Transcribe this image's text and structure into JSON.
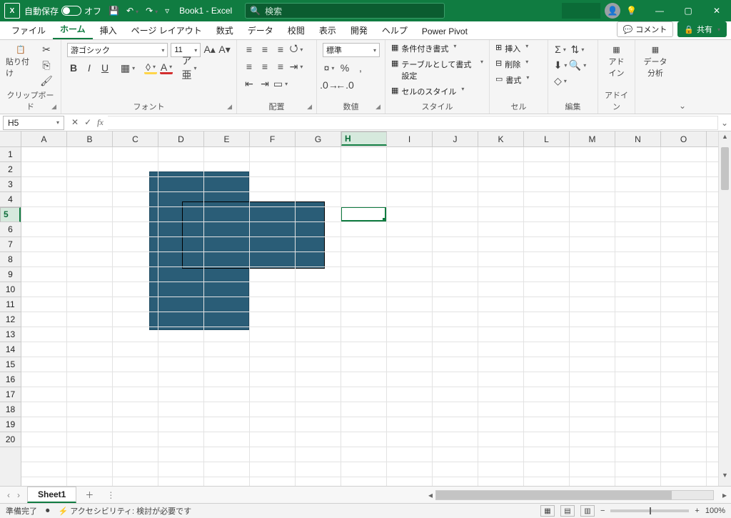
{
  "titlebar": {
    "autosave_label": "自動保存",
    "autosave_state": "オフ",
    "doc_title": "Book1 - Excel",
    "search_placeholder": "検索"
  },
  "tabs": {
    "file": "ファイル",
    "home": "ホーム",
    "insert": "挿入",
    "pagelayout": "ページ レイアウト",
    "formulas": "数式",
    "data": "データ",
    "review": "校閲",
    "view": "表示",
    "developer": "開発",
    "help": "ヘルプ",
    "powerpivot": "Power Pivot",
    "comment": "コメント",
    "share": "共有"
  },
  "ribbon": {
    "clipboard": {
      "paste": "貼り付け",
      "label": "クリップボード"
    },
    "font": {
      "name": "游ゴシック",
      "size": "11",
      "ruby": "ア亜",
      "label": "フォント"
    },
    "alignment": {
      "label": "配置"
    },
    "number": {
      "format": "標準",
      "label": "数値"
    },
    "styles": {
      "cond": "条件付き書式",
      "table": "テーブルとして書式設定",
      "cell": "セルのスタイル",
      "label": "スタイル"
    },
    "cells": {
      "insert": "挿入",
      "delete": "削除",
      "format": "書式",
      "label": "セル"
    },
    "editing": {
      "label": "編集"
    },
    "addins": {
      "btn": "アド\nイン",
      "label": "アドイン"
    },
    "analysis": {
      "btn": "データ\n分析"
    }
  },
  "namebox": "H5",
  "columns": [
    "A",
    "B",
    "C",
    "D",
    "E",
    "F",
    "G",
    "H",
    "I",
    "J",
    "K",
    "L",
    "M",
    "N",
    "O"
  ],
  "rows": [
    "1",
    "2",
    "3",
    "4",
    "5",
    "6",
    "7",
    "8",
    "9",
    "10",
    "11",
    "12",
    "13",
    "14",
    "15",
    "16",
    "17",
    "18",
    "19",
    "20"
  ],
  "selected": {
    "col_index": 7,
    "row_index": 4
  },
  "sheets": {
    "active": "Sheet1"
  },
  "status": {
    "ready": "準備完了",
    "accessibility": "アクセシビリティ: 検討が必要です",
    "zoom": "100%"
  }
}
